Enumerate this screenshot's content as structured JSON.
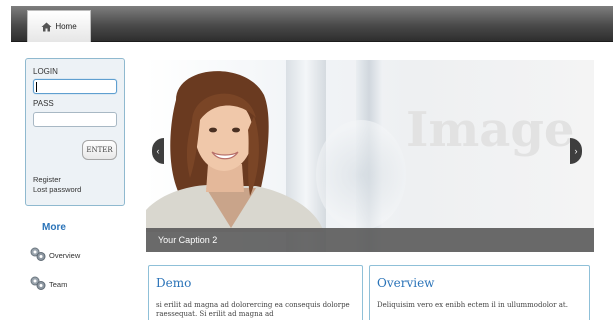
{
  "nav": {
    "home_label": "Home"
  },
  "login": {
    "login_label": "LOGIN",
    "login_value": "",
    "pass_label": "PASS",
    "pass_value": "",
    "enter_label": "ENTER",
    "register_link": "Register",
    "lost_password_link": "Lost password"
  },
  "sidebar": {
    "title": "More",
    "items": [
      {
        "label": "Overview",
        "icon": "gears-icon"
      },
      {
        "label": "Team",
        "icon": "gears-icon"
      }
    ]
  },
  "slider": {
    "watermark": "Image",
    "caption": "Your Caption 2",
    "prev_icon": "chevron-left-icon",
    "next_icon": "chevron-right-icon"
  },
  "boxes": [
    {
      "title": "Demo",
      "text": "si erilit ad magna ad dolorercing ea consequis dolorpe raessequat. Si erilit ad magna ad"
    },
    {
      "title": "Overview",
      "text": "Deliquisim vero ex enibh  ectem il in ullummodolor at."
    }
  ],
  "colors": {
    "accent": "#2a73b8",
    "border": "#8fc0d8",
    "topbar": "#3a3a3a"
  }
}
